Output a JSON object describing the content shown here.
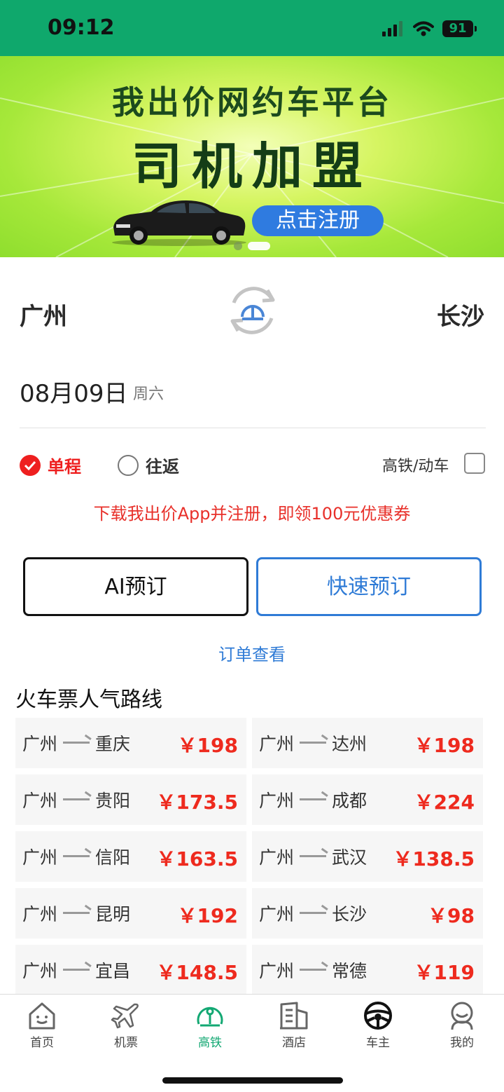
{
  "status_bar": {
    "time": "09:12",
    "battery": "91"
  },
  "banner": {
    "line1": "我出价网约车平台",
    "line2": "司机加盟",
    "cta": "点击注册"
  },
  "search": {
    "from_city": "广州",
    "to_city": "长沙",
    "date": "08月09日",
    "weekday": "周六"
  },
  "trip_type": {
    "one_way": "单程",
    "round_trip": "往返",
    "selected": "单程",
    "high_speed_label": "高铁/动车",
    "high_speed_checked": false
  },
  "promo_text": "下载我出价App并注册，即领100元优惠券",
  "buttons": {
    "ai_booking": "AI预订",
    "quick_booking": "快速预订"
  },
  "order_link": "订单查看",
  "popular_routes": {
    "title": "火车票人气路线",
    "items": [
      {
        "from": "广州",
        "to": "重庆",
        "price": "￥198"
      },
      {
        "from": "广州",
        "to": "达州",
        "price": "￥198"
      },
      {
        "from": "广州",
        "to": "贵阳",
        "price": "￥173.5"
      },
      {
        "from": "广州",
        "to": "成都",
        "price": "￥224"
      },
      {
        "from": "广州",
        "to": "信阳",
        "price": "￥163.5"
      },
      {
        "from": "广州",
        "to": "武汉",
        "price": "￥138.5"
      },
      {
        "from": "广州",
        "to": "昆明",
        "price": "￥192"
      },
      {
        "from": "广州",
        "to": "长沙",
        "price": "￥98"
      },
      {
        "from": "广州",
        "to": "宜昌",
        "price": "￥148.5"
      },
      {
        "from": "广州",
        "to": "常德",
        "price": "￥119"
      }
    ]
  },
  "tab_bar": {
    "active": "高铁",
    "items": [
      {
        "label": "首页",
        "icon": "home-icon"
      },
      {
        "label": "机票",
        "icon": "plane-icon"
      },
      {
        "label": "高铁",
        "icon": "train-icon"
      },
      {
        "label": "酒店",
        "icon": "hotel-icon"
      },
      {
        "label": "车主",
        "icon": "steering-wheel-icon"
      },
      {
        "label": "我的",
        "icon": "profile-icon"
      }
    ]
  },
  "colors": {
    "brand_green": "#0fa86c",
    "price_red": "#ee2a1e",
    "link_blue": "#2f7bd6",
    "tab_active": "#13a873"
  }
}
